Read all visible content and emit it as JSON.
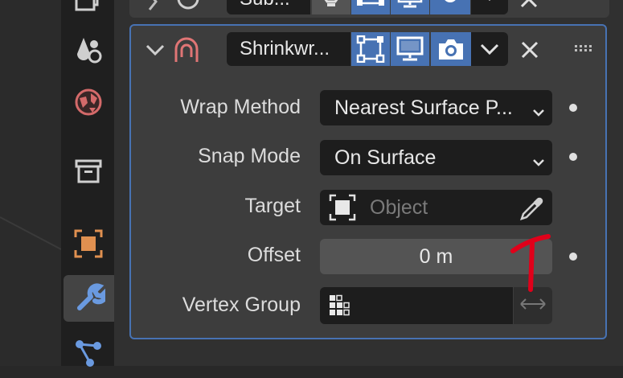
{
  "modifier": {
    "name": "Shrinkwr...",
    "top_modifier_name": "Sub..."
  },
  "fields": {
    "wrap_method_label": "Wrap Method",
    "wrap_method_value": "Nearest Surface P...",
    "snap_mode_label": "Snap Mode",
    "snap_mode_value": "On Surface",
    "target_label": "Target",
    "target_placeholder": "Object",
    "offset_label": "Offset",
    "offset_value": "0 m",
    "vertex_group_label": "Vertex Group",
    "vertex_group_value": ""
  },
  "colors": {
    "accent": "#4772b3",
    "panel": "#3d3d3d",
    "field": "#1d1d1d",
    "annotation": "#e0001a"
  },
  "icons": {
    "tabs": [
      "output-properties-icon",
      "physics-icon",
      "world-icon",
      "collection-icon",
      "object-icon",
      "modifier-wrench-icon",
      "particles-icon"
    ],
    "header": [
      "collapse-chevron-icon",
      "shrinkwrap-modifier-icon",
      "edit-mode-toggle-icon",
      "viewport-toggle-icon",
      "render-toggle-icon",
      "dropdown-chevron-icon",
      "close-icon",
      "drag-handle-icon"
    ]
  }
}
